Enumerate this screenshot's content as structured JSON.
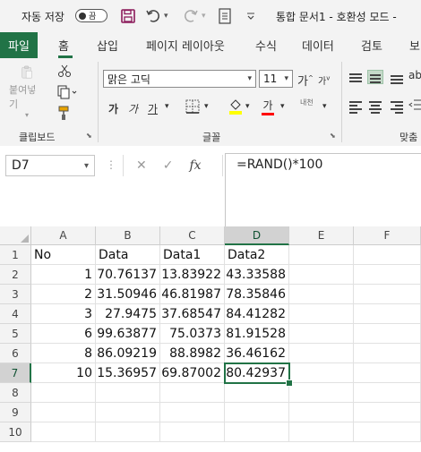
{
  "titlebar": {
    "autosave_label": "자동 저장",
    "autosave_state": "끔",
    "doc_title": "통합 문서1 - 호환성 모드 -"
  },
  "icons": {
    "save": "save-icon",
    "undo": "undo-icon",
    "redo": "redo-icon",
    "form": "form-icon",
    "customize": "chevron-down-icon"
  },
  "tabs": [
    "파일",
    "홈",
    "삽입",
    "페이지 레이아웃",
    "수식",
    "데이터",
    "검토",
    "보"
  ],
  "ribbon": {
    "clipboard": {
      "paste_label": "붙여넣기",
      "group_label": "클립보드"
    },
    "font": {
      "font_name": "맑은 고딕",
      "font_size": "11",
      "grow": "가",
      "shrink": "가",
      "bold": "가",
      "italic": "가",
      "underline": "가",
      "font_color_glyph": "가",
      "phonetic": "내천",
      "group_label": "글꼴"
    },
    "alignment": {
      "group_label": "맞춤"
    }
  },
  "formula_bar": {
    "name_box": "D7",
    "fx_label": "fx",
    "formula": "=RAND()*100"
  },
  "sheet": {
    "columns": [
      "A",
      "B",
      "C",
      "D",
      "E",
      "F"
    ],
    "rows": [
      "1",
      "2",
      "3",
      "4",
      "5",
      "6",
      "7",
      "8",
      "9",
      "10"
    ],
    "headers": [
      "No",
      "Data",
      "Data1",
      "Data2"
    ],
    "data": [
      [
        "1",
        "70.76137",
        "13.83922",
        "43.33588"
      ],
      [
        "2",
        "31.50946",
        "46.81987",
        "78.35846"
      ],
      [
        "3",
        "27.9475",
        "37.68547",
        "84.41282"
      ],
      [
        "6",
        "99.63877",
        "75.0373",
        "81.91528"
      ],
      [
        "8",
        "86.09219",
        "88.8982",
        "36.46162"
      ],
      [
        "10",
        "15.36957",
        "69.87002",
        "80.42937"
      ]
    ],
    "active_cell": "D7"
  },
  "colors": {
    "accent": "#217346",
    "ribbon_bg": "#f3f3f3",
    "header_selected": "#d2d2d2"
  }
}
